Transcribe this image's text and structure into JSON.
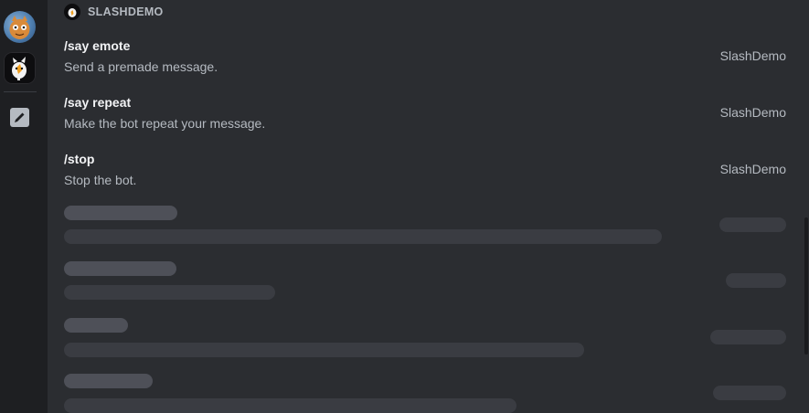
{
  "app_header": {
    "name": "SLASHDEMO"
  },
  "commands": [
    {
      "title": "/say emote",
      "description": "Send a premade message.",
      "source": "SlashDemo"
    },
    {
      "title": "/say repeat",
      "description": "Make the bot repeat your message.",
      "source": "SlashDemo"
    },
    {
      "title": "/stop",
      "description": "Stop the bot.",
      "source": "SlashDemo"
    }
  ],
  "rail": {
    "icons": [
      "user-avatar-icon",
      "bot-avatar-icon",
      "edit-icon"
    ]
  },
  "colors": {
    "background": "#2b2d31",
    "rail": "#1e1f22",
    "title_text": "#f2f3f5",
    "muted_text": "#b5bac1",
    "skeleton_title": "#4e5058",
    "skeleton_line": "#3a3c42"
  }
}
